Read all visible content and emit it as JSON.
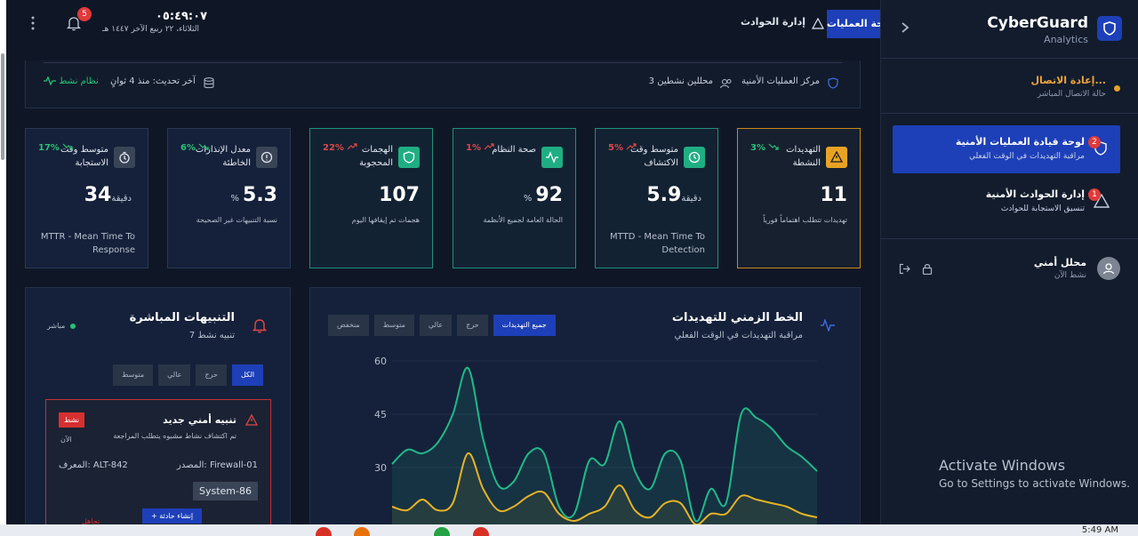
{
  "sidebar": {
    "brand_name": "CyberGuard",
    "brand_sub": "Analytics",
    "connection": {
      "title": "إعادة الاتصال...",
      "subtitle": "حالة الاتصال المباشر"
    },
    "nav": [
      {
        "title": "لوحة قيادة العمليات الأمنية",
        "subtitle": "مراقبة التهديدات في الوقت الفعلي",
        "badge": "2",
        "active": true
      },
      {
        "title": "إدارة الحوادث الأمنية",
        "subtitle": "تنسيق الاستجابة للحوادث",
        "badge": "1",
        "active": false
      }
    ],
    "user": {
      "name": "محلل أمني",
      "status": "نشط الآن"
    }
  },
  "activation": {
    "title": "Activate Windows",
    "subtitle": "Go to Settings to activate Windows."
  },
  "header": {
    "tab_ops": "لوحة العمليات",
    "tab_incidents": "إدارة الحوادث",
    "clock": "٠٥:٤٩:٠٧",
    "date": "الثلاثاء، ٢٢ ربيع الآخر ١٤٤٧ هـ",
    "notifications": "5"
  },
  "status": {
    "center": "مركز العمليات الأمنية",
    "analysts": "3 محللين نشطين",
    "last_update": "آخر تحديث: منذ 4 ثوانٍ",
    "system": "نظام نشط"
  },
  "cards": [
    {
      "label": "التهديدات النشطة",
      "change": "3%",
      "dir": "down",
      "value": "11",
      "unit": "",
      "desc": "تهديدات تتطلب اهتماماً فورياً",
      "eng": "",
      "style": "amber",
      "icon_color": "#e8a324"
    },
    {
      "label": "متوسط وقت الاكتشاف",
      "change": "5%",
      "dir": "up",
      "value": "5.9",
      "unit": "دقيقة",
      "desc": "",
      "eng": "MTTD - Mean Time To Detection",
      "style": "teal",
      "icon_color": "#1fae82"
    },
    {
      "label": "صحة النظام",
      "change": "1%",
      "dir": "up",
      "value": "92",
      "unit": "%",
      "desc": "الحالة العامة لجميع الأنظمة",
      "eng": "",
      "style": "teal",
      "icon_color": "#1fae82"
    },
    {
      "label": "الهجمات المحجوبة",
      "change": "22%",
      "dir": "up",
      "value": "107",
      "unit": "",
      "desc": "هجمات تم إيقافها اليوم",
      "eng": "",
      "style": "teal",
      "icon_color": "#1fae82"
    },
    {
      "label": "معدل الإنذارات الخاطئة",
      "change": "6%",
      "dir": "down",
      "value": "5.3",
      "unit": "%",
      "desc": "نسبة التنبيهات غير الصحيحة",
      "eng": "",
      "style": "plain",
      "icon_color": "#3a4457"
    },
    {
      "label": "متوسط وقت الاستجابة",
      "change": "17%",
      "dir": "down",
      "value": "34",
      "unit": "دقيقة",
      "desc": "",
      "eng": "MTTR - Mean Time To Response",
      "style": "plain",
      "icon_color": "#3a4457"
    }
  ],
  "timeline": {
    "title": "الخط الزمني للتهديدات",
    "subtitle": "مراقبة التهديدات في الوقت الفعلي",
    "filters": [
      "جميع التهديدات",
      "حرج",
      "عالي",
      "متوسط",
      "منخفض"
    ]
  },
  "chart_data": {
    "type": "area",
    "yticks": [
      "60",
      "45",
      "30"
    ],
    "ylim": [
      15,
      63
    ],
    "series": [
      {
        "color": "#1fb98a",
        "values": [
          31,
          35,
          34,
          37,
          45,
          58,
          38,
          25,
          26,
          34,
          34,
          19,
          17,
          32,
          31,
          43,
          29,
          24,
          34,
          32,
          15,
          24,
          20,
          45,
          44,
          41,
          36,
          33,
          29
        ]
      },
      {
        "color": "#e6b325",
        "values": [
          19,
          18,
          21,
          18,
          20,
          34,
          24,
          18,
          19,
          22,
          23,
          17,
          15,
          17,
          19,
          25,
          18,
          16,
          20,
          20,
          14,
          17,
          17,
          22,
          21,
          20,
          19,
          17,
          16
        ]
      }
    ]
  },
  "alerts": {
    "title": "التنبيهات المباشرة",
    "count": "7 تنبيه نشط",
    "live": "مباشر",
    "filters": [
      "الكل",
      "حرج",
      "عالي",
      "متوسط"
    ],
    "card": {
      "title": "تنبيه أمني جديد",
      "desc": "تم اكتشاف نشاط مشبوه يتطلب المراجعة",
      "badge": "نشط",
      "time": "الآن",
      "source": "المصدر: Firewall-01",
      "id": "المعرف: ALT-842",
      "system": "System-86",
      "create": "+ إنشاء حادثة",
      "ignore": "تجاهل"
    }
  },
  "taskbar": {
    "time": "5:49 AM"
  }
}
